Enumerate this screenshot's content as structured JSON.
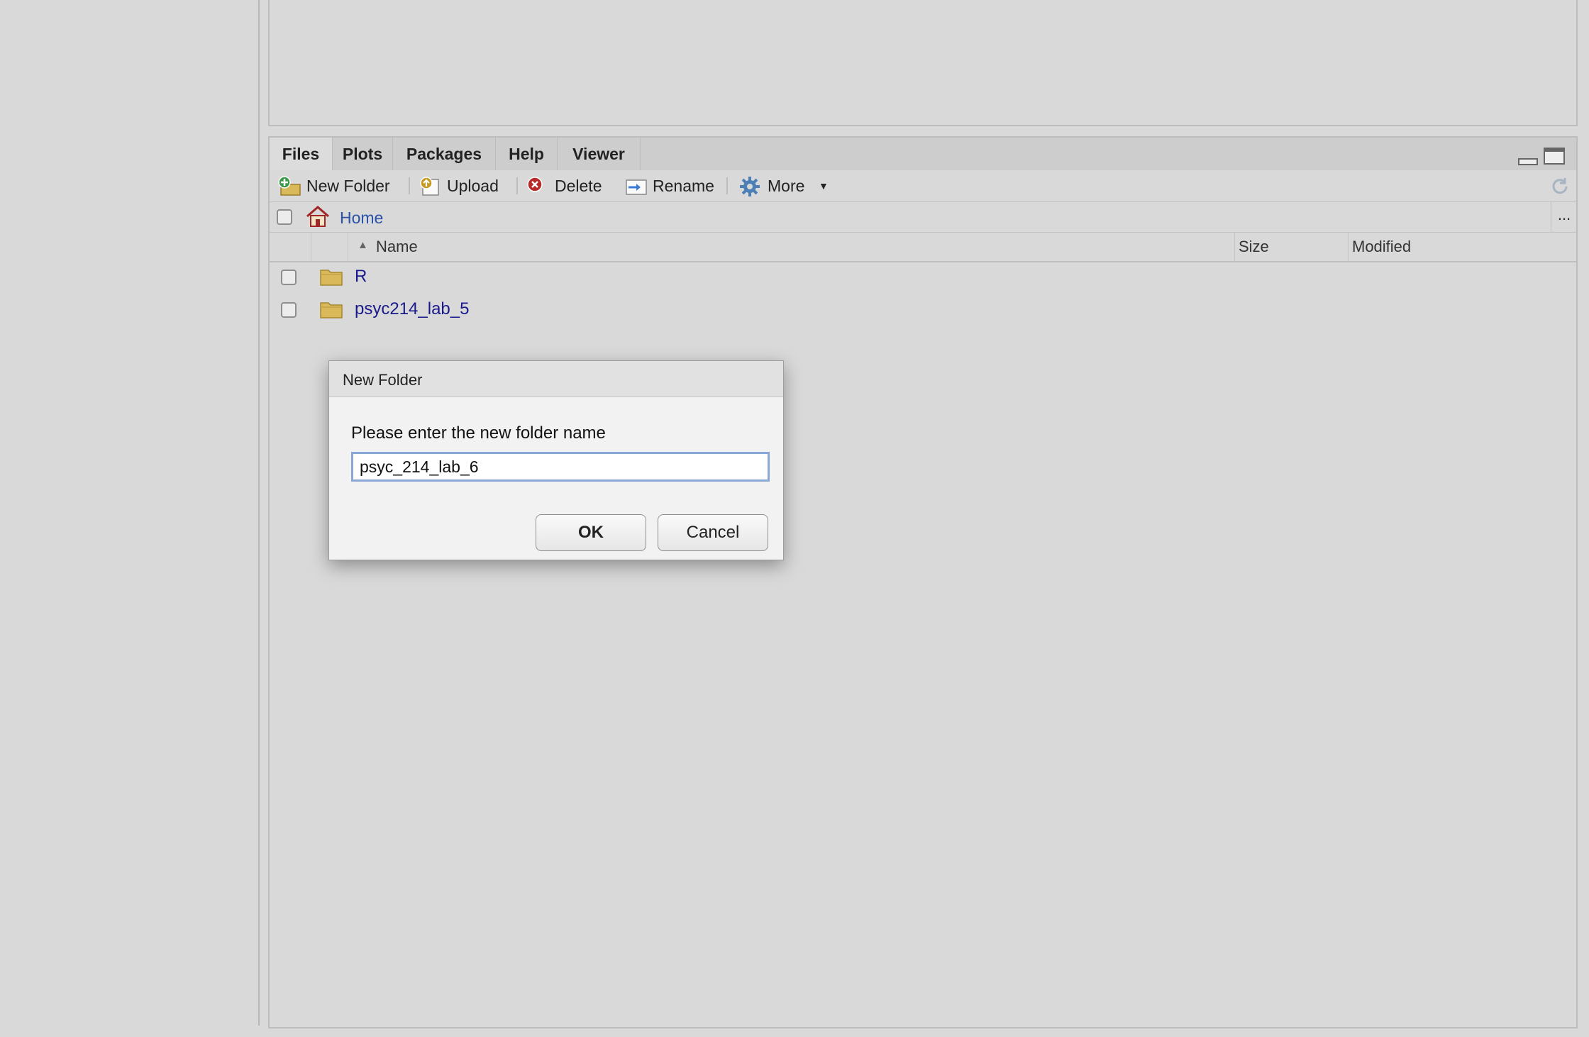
{
  "tabs": [
    {
      "label": "Files",
      "active": true
    },
    {
      "label": "Plots",
      "active": false
    },
    {
      "label": "Packages",
      "active": false
    },
    {
      "label": "Help",
      "active": false
    },
    {
      "label": "Viewer",
      "active": false
    }
  ],
  "toolbar": {
    "new_folder": "New Folder",
    "upload": "Upload",
    "delete": "Delete",
    "rename": "Rename",
    "more": "More"
  },
  "path": {
    "home": "Home",
    "overflow": "..."
  },
  "columns": {
    "name": "Name",
    "size": "Size",
    "modified": "Modified"
  },
  "files": [
    {
      "name": "R",
      "type": "folder"
    },
    {
      "name": "psyc214_lab_5",
      "type": "folder"
    }
  ],
  "dialog": {
    "title": "New Folder",
    "prompt": "Please enter the new folder name",
    "input_value": "psyc_214_lab_6",
    "ok": "OK",
    "cancel": "Cancel"
  },
  "colors": {
    "link": "#1a1a8c",
    "folder": "#d9b95a",
    "input_focus": "#8aa8d6"
  }
}
